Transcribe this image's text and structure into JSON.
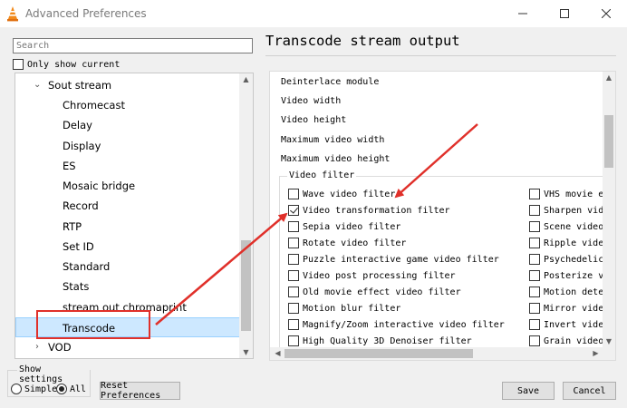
{
  "window": {
    "title": "Advanced Preferences",
    "icons": {
      "app": "vlc-cone-icon",
      "minimize": "minimize-icon",
      "maximize": "maximize-icon",
      "close": "close-icon"
    }
  },
  "search": {
    "placeholder": "Search",
    "value": ""
  },
  "only_current": {
    "label": "Only show current",
    "checked": false
  },
  "tree": {
    "items": [
      {
        "label": "Sout stream",
        "expanded": true
      },
      {
        "label": "Chromecast"
      },
      {
        "label": "Delay"
      },
      {
        "label": "Display"
      },
      {
        "label": "ES"
      },
      {
        "label": "Mosaic bridge"
      },
      {
        "label": "Record"
      },
      {
        "label": "RTP"
      },
      {
        "label": "Set ID"
      },
      {
        "label": "Standard"
      },
      {
        "label": "Stats"
      },
      {
        "label": "stream out chromaprint"
      },
      {
        "label": "Transcode",
        "selected": true
      },
      {
        "label": "VOD",
        "expanded": false
      }
    ]
  },
  "show_settings": {
    "title": "Show settings",
    "simple": "Simple",
    "all": "All",
    "selected": "All"
  },
  "buttons": {
    "reset": "Reset Preferences",
    "save": "Save",
    "cancel": "Cancel"
  },
  "panel": {
    "title": "Transcode stream output",
    "options": [
      "Deinterlace module",
      "Video width",
      "Video height",
      "Maximum video width",
      "Maximum video height"
    ],
    "video_filter": {
      "title": "Video filter",
      "left": [
        {
          "label": "Wave video filter",
          "checked": false
        },
        {
          "label": "Video transformation filter",
          "checked": true
        },
        {
          "label": "Sepia video filter",
          "checked": false
        },
        {
          "label": "Rotate video filter",
          "checked": false
        },
        {
          "label": "Puzzle interactive game video filter",
          "checked": false
        },
        {
          "label": "Video post processing filter",
          "checked": false
        },
        {
          "label": "Old movie effect video filter",
          "checked": false
        },
        {
          "label": "Motion blur filter",
          "checked": false
        },
        {
          "label": "Magnify/Zoom interactive video filter",
          "checked": false
        },
        {
          "label": "High Quality 3D Denoiser filter",
          "checked": false
        }
      ],
      "right": [
        {
          "label": "VHS movie effe",
          "checked": false
        },
        {
          "label": "Sharpen video",
          "checked": false
        },
        {
          "label": "Scene video fi",
          "checked": false
        },
        {
          "label": "Ripple video f",
          "checked": false
        },
        {
          "label": "Psychedelic vi",
          "checked": false
        },
        {
          "label": "Posterize vide",
          "checked": false
        },
        {
          "label": "Motion detect",
          "checked": false
        },
        {
          "label": "Mirror video f",
          "checked": false
        },
        {
          "label": "Invert video f",
          "checked": false
        },
        {
          "label": "Grain video fi",
          "checked": false
        }
      ]
    }
  },
  "colors": {
    "annotation": "#e0302a",
    "selection": "#cde8ff",
    "selection_border": "#99d1ff"
  }
}
